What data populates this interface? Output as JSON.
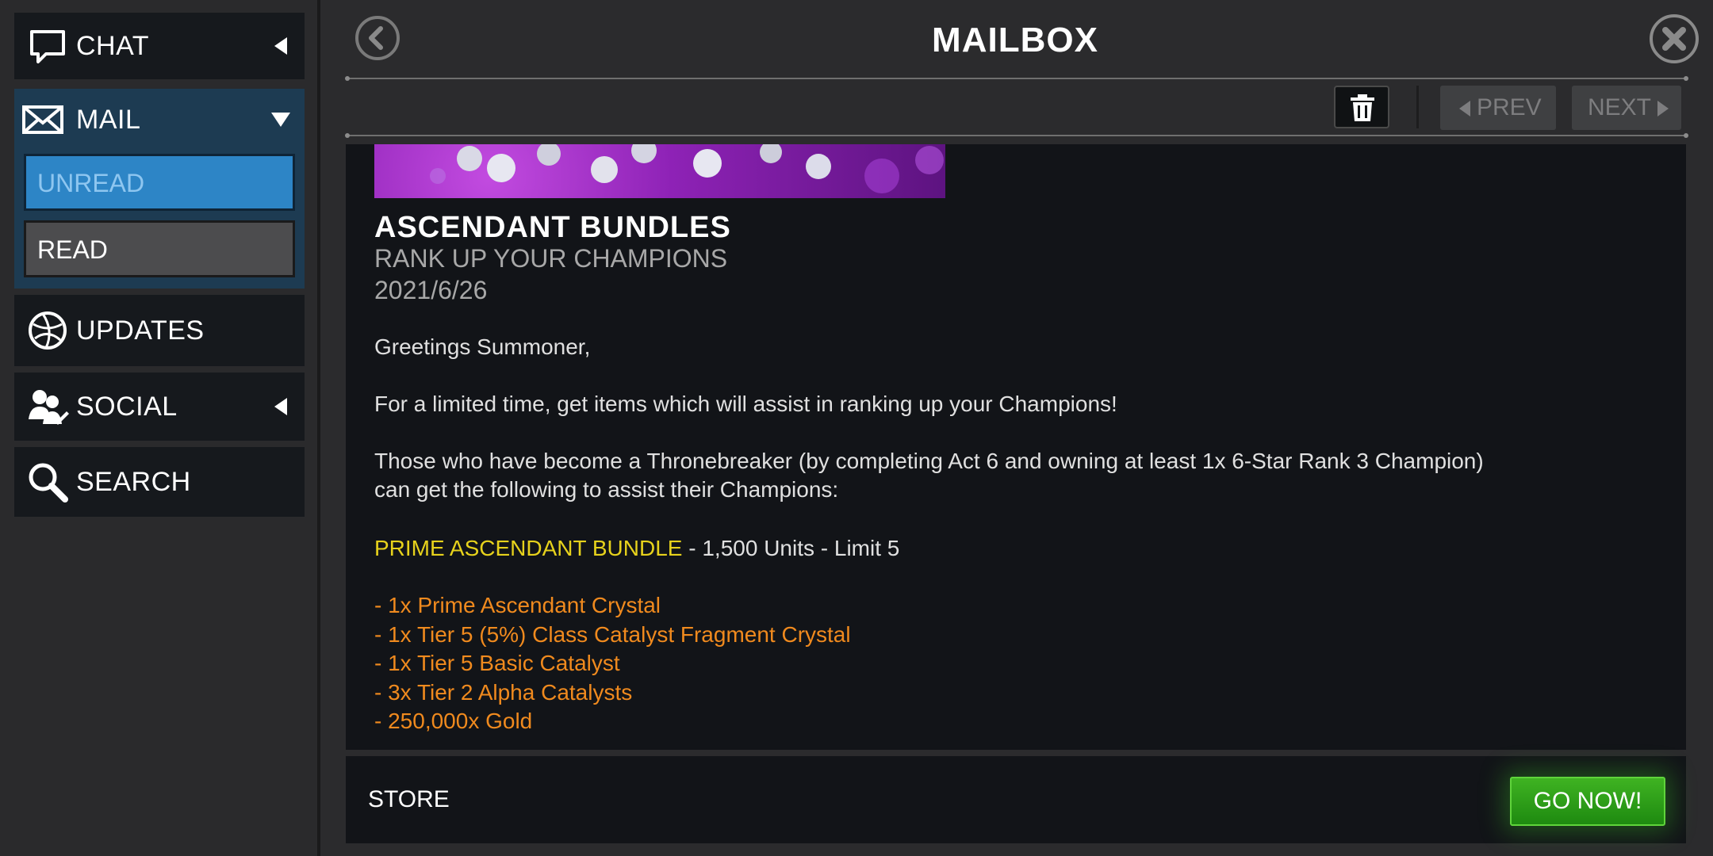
{
  "sidebar": {
    "chat": {
      "label": "CHAT",
      "icon": "speech-bubble-icon"
    },
    "mail": {
      "label": "MAIL",
      "icon": "envelope-icon",
      "sub": {
        "unread": "UNREAD",
        "read": "READ"
      }
    },
    "updates": {
      "label": "UPDATES",
      "icon": "globe-icon"
    },
    "social": {
      "label": "SOCIAL",
      "icon": "people-icon"
    },
    "search": {
      "label": "SEARCH",
      "icon": "magnifier-icon"
    }
  },
  "header": {
    "title": "MAILBOX"
  },
  "toolbar": {
    "prev_label": "PREV",
    "next_label": "NEXT"
  },
  "message": {
    "title": "ASCENDANT BUNDLES",
    "subtitle": "RANK UP YOUR CHAMPIONS",
    "date": "2021/6/26",
    "greeting": "Greetings Summoner,",
    "para1": "For a limited time, get items which will assist in ranking up your Champions!",
    "para2_line1": "Those who have become a Thronebreaker (by completing Act 6 and owning at least 1x 6-Star Rank 3 Champion)",
    "para2_line2": "can get the following to assist their Champions:",
    "bundle_name": "PRIME ASCENDANT BUNDLE",
    "bundle_rest": " - 1,500 Units - Limit 5",
    "items": [
      "- 1x Prime Ascendant Crystal",
      "- 1x Tier 5 (5%) Class Catalyst Fragment Crystal",
      "- 1x Tier 5 Basic Catalyst",
      "- 3x Tier 2 Alpha Catalysts",
      "- 250,000x Gold"
    ]
  },
  "footer": {
    "store_label": "STORE",
    "go_label": "GO NOW!"
  },
  "colors": {
    "accent_blue": "#2d85c6",
    "bundle_yellow": "#e7d21c",
    "item_orange": "#f08a1e",
    "go_green": "#2fa01a"
  }
}
